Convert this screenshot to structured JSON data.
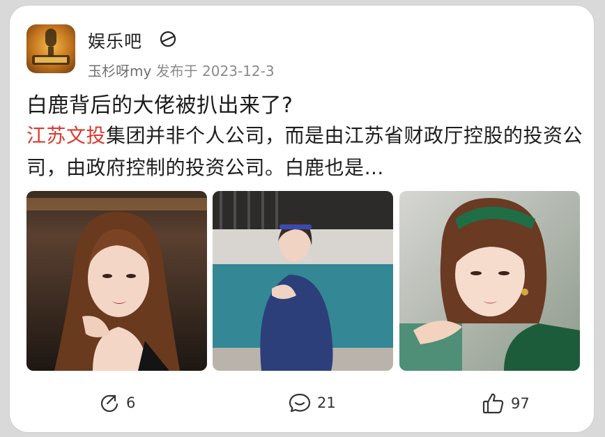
{
  "post": {
    "forum_name": "娱乐吧",
    "author": "玉杉呀my",
    "published_label": "发布于",
    "date": "2023-12-3",
    "title": "白鹿背后的大佬被扒出来了?",
    "body_highlight": "江苏文投",
    "body_rest": "集团并非个人公司，而是由江苏省财政厅控股的投资公司，由政府控制的投资公司。白鹿也是…"
  },
  "stats": {
    "shares": "6",
    "comments": "21",
    "likes": "97"
  },
  "icons": {
    "follow": "no-entry-circle-icon",
    "share": "share-icon",
    "comment": "comment-icon",
    "like": "thumbs-up-icon"
  },
  "colors": {
    "highlight": "#d93a2f"
  }
}
